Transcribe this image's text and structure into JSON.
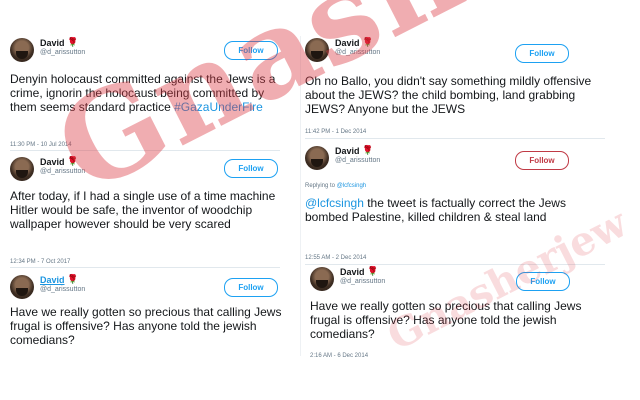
{
  "tweets": [
    {
      "name": "David",
      "handle": "@d_arissutton",
      "follow": "Follow",
      "text": "Denyin holocaust committed against the Jews is a crime, ignorin the holocaust being committed by them seems standard practice",
      "hashtag": "#GazaUnderFire",
      "time": "11:30 PM - 10 Jul 2014"
    },
    {
      "name": "David",
      "handle": "@d_arissutton",
      "follow": "Follow",
      "text": "After today, if I had a single use of a time machine Hitler would be safe, the inventor of woodchip wallpaper however should be very scared",
      "time": "12:34 PM - 7 Oct 2017"
    },
    {
      "name": "David",
      "handle": "@d_arissutton",
      "follow": "Follow",
      "text": "Have we really gotten so precious that calling Jews frugal is offensive? Has anyone told the jewish comedians?",
      "time": ""
    },
    {
      "name": "David",
      "handle": "@d_arissutton",
      "follow": "Follow",
      "text": "Oh no Ballo, you didn't say something mildly offensive about the JEWS? the child bombing, land grabbing JEWS? Anyone but the JEWS",
      "time": "11:42 PM - 1 Dec 2014"
    },
    {
      "name": "David",
      "handle": "@d_arissutton",
      "follow": "Follow",
      "reply_prefix": "Replying to",
      "reply_to": "@lcfcsingh",
      "mention": "@lcfcsingh",
      "text": " the tweet is factually correct the Jews bombed Palestine, killed children & steal land",
      "time": "12:55 AM - 2 Dec 2014"
    },
    {
      "name": "David",
      "handle": "@d_arissutton",
      "follow": "Follow",
      "text": "Have we really gotten so precious that calling Jews frugal is offensive? Has anyone told the jewish comedians?",
      "time": "2:16 AM - 6 Dec 2014"
    }
  ],
  "watermark": "Gnasherjew",
  "colors": {
    "link": "#1b95e0",
    "follow_blue": "#1da1f2",
    "follow_red": "#c03a45",
    "watermark": "#dc3c46"
  },
  "icons": {
    "avatar": "avatar-photo",
    "rose": "rose-icon"
  }
}
